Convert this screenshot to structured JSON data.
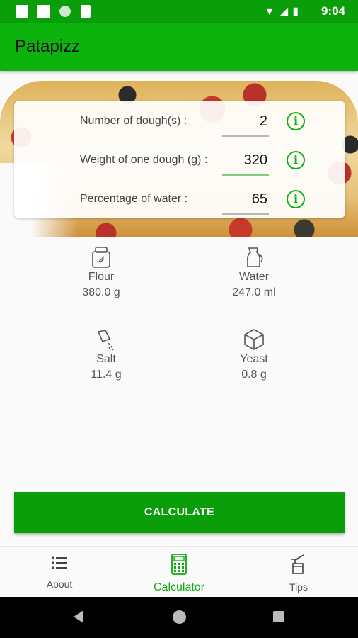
{
  "status_bar": {
    "time": "9:04"
  },
  "app": {
    "title": "Patapizz"
  },
  "inputs": [
    {
      "label": "Number of dough(s) :",
      "value": "2"
    },
    {
      "label": "Weight of one dough (g) :",
      "value": "320"
    },
    {
      "label": "Percentage of water :",
      "value": "65"
    }
  ],
  "results": {
    "flour": {
      "name": "Flour",
      "amount": "380.0 g"
    },
    "water": {
      "name": "Water",
      "amount": "247.0 ml"
    },
    "salt": {
      "name": "Salt",
      "amount": "11.4 g"
    },
    "yeast": {
      "name": "Yeast",
      "amount": "0.8 g"
    }
  },
  "actions": {
    "calculate": "CALCULATE"
  },
  "bottom_nav": [
    {
      "label": "About",
      "icon": "list-icon",
      "active": false
    },
    {
      "label": "Calculator",
      "icon": "calculator-icon",
      "active": true
    },
    {
      "label": "Tips",
      "icon": "tips-icon",
      "active": false
    }
  ],
  "colors": {
    "primary": "#0cb30c",
    "primary_dark": "#0a9e0a",
    "accent": "#10b010"
  }
}
